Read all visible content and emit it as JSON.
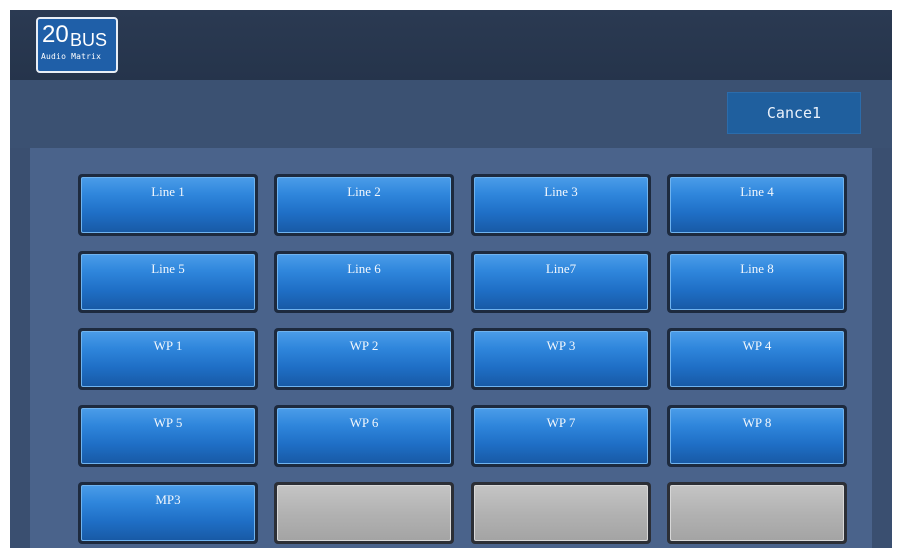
{
  "logo": {
    "number": "20",
    "word": "BUS",
    "subtitle": "Audio Matrix"
  },
  "toolbar": {
    "cancel_label": "Cance1"
  },
  "grid": {
    "rows": [
      [
        "Line 1",
        "Line 2",
        "Line 3",
        "Line 4"
      ],
      [
        "Line 5",
        "Line 6",
        "Line7",
        "Line 8"
      ],
      [
        "WP 1",
        "WP  2",
        "WP  3",
        "WP  4"
      ],
      [
        "WP 5",
        "WP  6",
        "WP  7",
        "WP  8"
      ],
      [
        "MP3",
        "",
        "",
        ""
      ]
    ]
  },
  "colors": {
    "button_blue": "#2f86dc",
    "empty_gray": "#b2b2b2",
    "background": "#3a4f70"
  }
}
